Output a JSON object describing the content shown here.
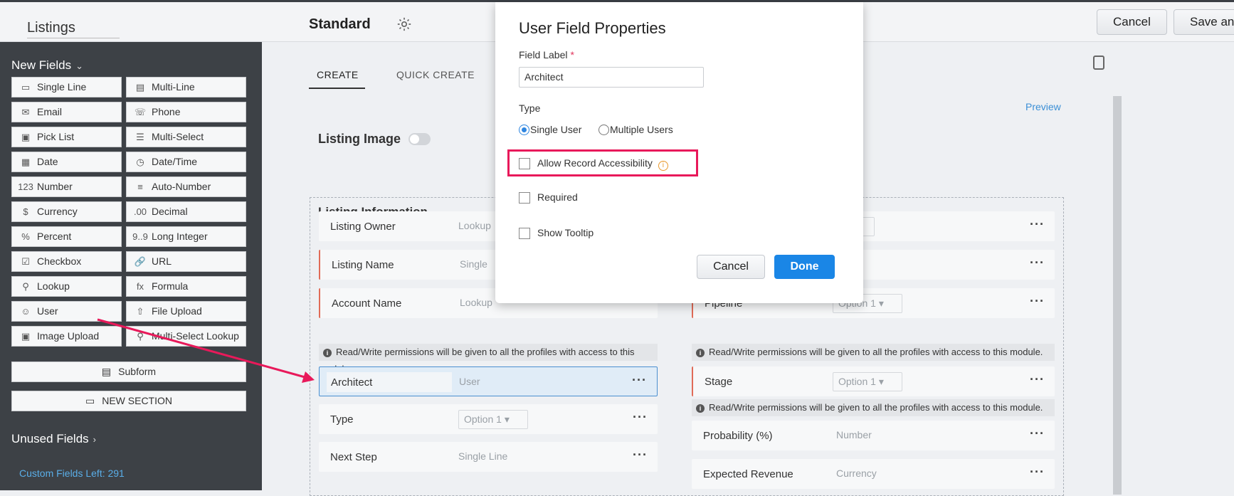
{
  "header": {
    "module_name": "Listings",
    "layout_name": "Standard",
    "cancel_label": "Cancel",
    "save_label": "Save and"
  },
  "sidebar": {
    "new_fields_label": "New Fields",
    "fields": [
      {
        "label": "Single Line",
        "icon": "single-line-icon"
      },
      {
        "label": "Multi-Line",
        "icon": "multi-line-icon"
      },
      {
        "label": "Email",
        "icon": "email-icon"
      },
      {
        "label": "Phone",
        "icon": "phone-icon"
      },
      {
        "label": "Pick List",
        "icon": "picklist-icon"
      },
      {
        "label": "Multi-Select",
        "icon": "multi-select-icon"
      },
      {
        "label": "Date",
        "icon": "date-icon"
      },
      {
        "label": "Date/Time",
        "icon": "datetime-icon"
      },
      {
        "label": "Number",
        "icon": "number-icon"
      },
      {
        "label": "Auto-Number",
        "icon": "auto-number-icon"
      },
      {
        "label": "Currency",
        "icon": "currency-icon"
      },
      {
        "label": "Decimal",
        "icon": "decimal-icon"
      },
      {
        "label": "Percent",
        "icon": "percent-icon"
      },
      {
        "label": "Long Integer",
        "icon": "long-integer-icon"
      },
      {
        "label": "Checkbox",
        "icon": "checkbox-icon"
      },
      {
        "label": "URL",
        "icon": "url-icon"
      },
      {
        "label": "Lookup",
        "icon": "lookup-icon"
      },
      {
        "label": "Formula",
        "icon": "formula-icon"
      },
      {
        "label": "User",
        "icon": "user-icon"
      },
      {
        "label": "File Upload",
        "icon": "file-upload-icon"
      },
      {
        "label": "Image Upload",
        "icon": "image-upload-icon"
      },
      {
        "label": "Multi-Select Lookup",
        "icon": "multi-select-lookup-icon"
      }
    ],
    "subform_label": "Subform",
    "new_section_label": "NEW SECTION",
    "unused_fields_label": "Unused Fields",
    "custom_fields_left": "Custom Fields Left: 291"
  },
  "tabs": [
    "CREATE",
    "QUICK CREATE"
  ],
  "preview_label": "Preview",
  "listing_image_label": "Listing Image",
  "section": {
    "title": "Listing Information",
    "permission_note": "Read/Write permissions will be given to all the profiles with access to this module.",
    "left_fields": [
      {
        "label": "Listing Owner",
        "type": "Lookup"
      },
      {
        "label": "Listing Name",
        "type": "Single"
      },
      {
        "label": "Account Name",
        "type": "Lookup"
      },
      {
        "label": "Architect",
        "type": "User"
      },
      {
        "label": "Type",
        "type": "Option 1"
      },
      {
        "label": "Next Step",
        "type": "Single Line"
      }
    ],
    "right_fields": [
      {
        "label": "",
        "type": "ion 1"
      },
      {
        "label": "Pipeline",
        "type": "Option 1"
      },
      {
        "label": "Stage",
        "type": "Option 1"
      },
      {
        "label": "Probability (%)",
        "type": "Number"
      },
      {
        "label": "Expected Revenue",
        "type": "Currency"
      }
    ]
  },
  "modal": {
    "title": "User Field Properties",
    "field_label_caption": "Field Label",
    "required_mark": "*",
    "field_label_value": "Architect",
    "type_caption": "Type",
    "type_options": [
      "Single User",
      "Multiple Users"
    ],
    "selected_type": "Single User",
    "allow_record_accessibility": "Allow Record Accessibility",
    "required": "Required",
    "show_tooltip": "Show Tooltip",
    "cancel_label": "Cancel",
    "done_label": "Done",
    "colors": {
      "highlight": "#e8195a",
      "done": "#1a86e6"
    }
  }
}
